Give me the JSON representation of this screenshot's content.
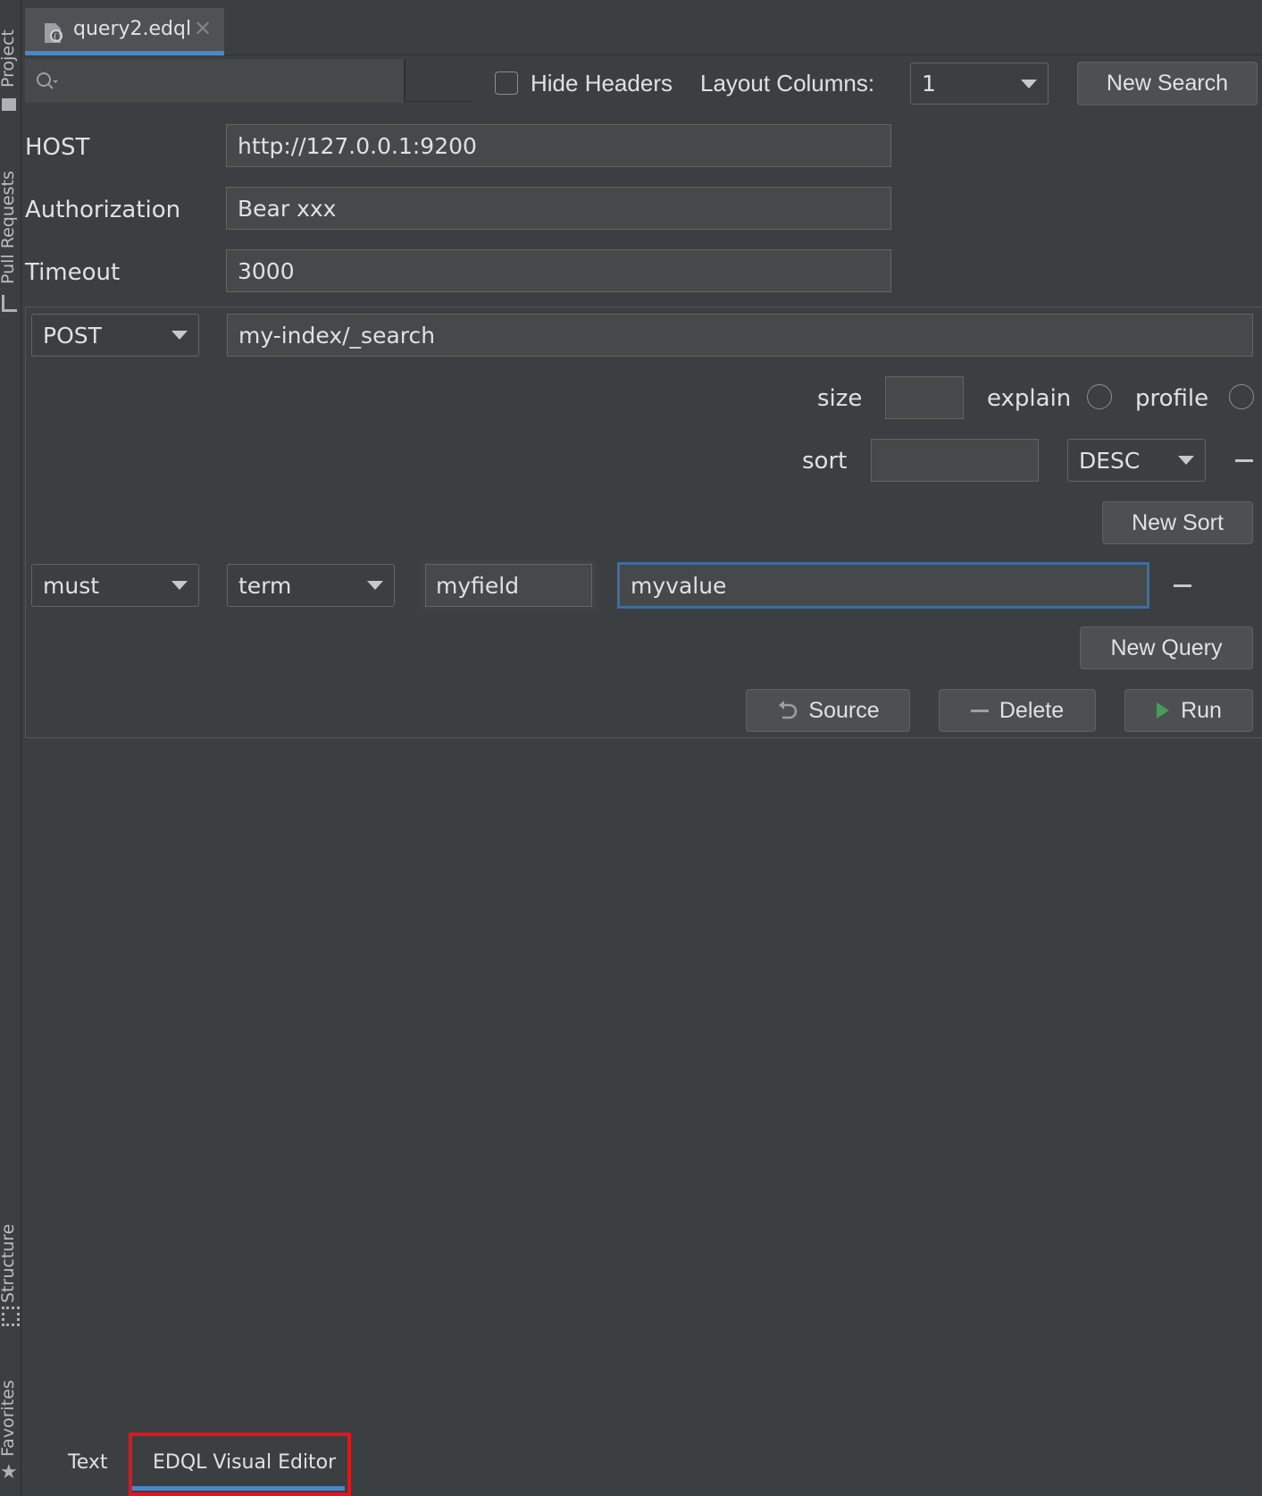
{
  "sidebar": {
    "project": "Project",
    "pull_requests": "Pull Requests",
    "structure": "Structure",
    "favorites": "Favorites"
  },
  "editor_tab": {
    "label": "query2.edql",
    "close": "✕"
  },
  "toolbar": {
    "search_value": "",
    "hide_headers_label": "Hide Headers",
    "hide_headers_checked": false,
    "layout_columns_label": "Layout Columns:",
    "layout_columns_value": "1",
    "new_search_label": "New Search"
  },
  "connection": {
    "host_label": "HOST",
    "host_value": "http://127.0.0.1:9200",
    "auth_label": "Authorization",
    "auth_value": "Bear xxx",
    "timeout_label": "Timeout",
    "timeout_value": "3000"
  },
  "request": {
    "method": "POST",
    "path": "my-index/_search",
    "size_label": "size",
    "size_value": "",
    "explain_label": "explain",
    "profile_label": "profile",
    "sort_label": "sort",
    "sort_value": "",
    "sort_order": "DESC",
    "new_sort_label": "New Sort"
  },
  "query": {
    "occur": "must",
    "type": "term",
    "field": "myfield",
    "value": "myvalue",
    "new_query_label": "New Query"
  },
  "actions": {
    "source_label": "Source",
    "delete_label": "Delete",
    "run_label": "Run"
  },
  "bottom_tabs": {
    "text": "Text",
    "visual": "EDQL Visual Editor"
  },
  "colors": {
    "background": "#3c3f41",
    "accent": "#4a88c7",
    "highlight": "#e5141b",
    "run": "#499c54"
  }
}
